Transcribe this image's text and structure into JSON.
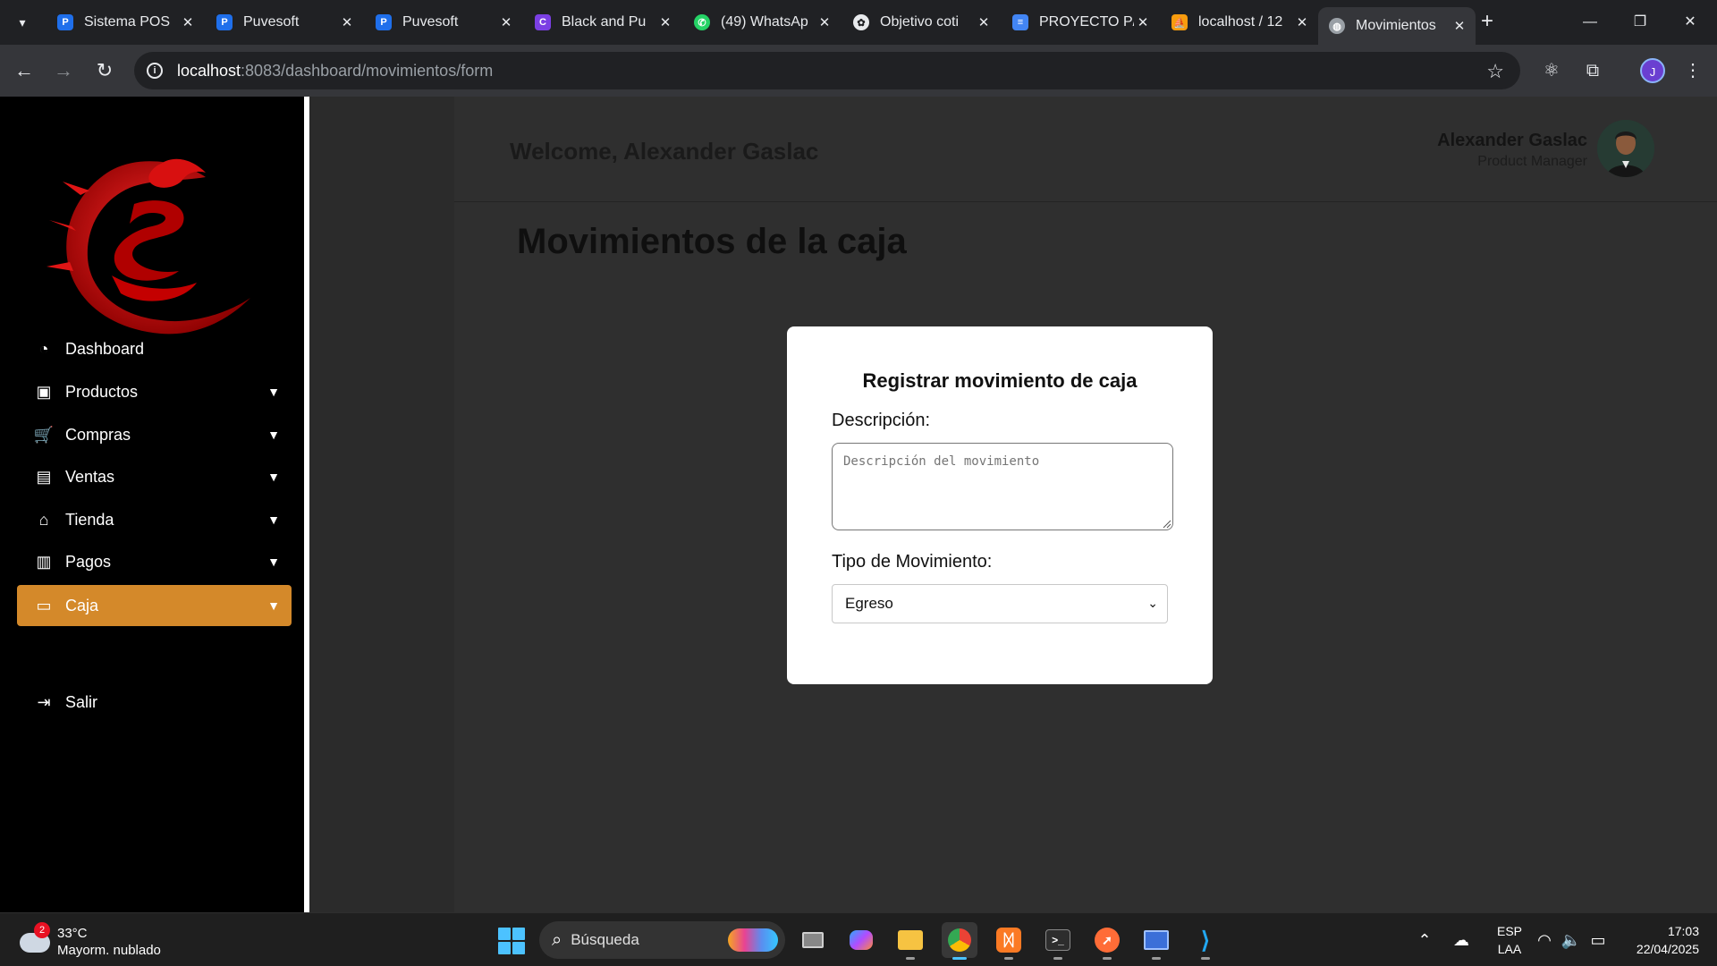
{
  "browser": {
    "tabs": [
      {
        "title": "Sistema POS",
        "icon": "puvesoft-icon"
      },
      {
        "title": "Puvesoft",
        "icon": "puvesoft-icon"
      },
      {
        "title": "Puvesoft",
        "icon": "puvesoft-icon"
      },
      {
        "title": "Black and Pu",
        "icon": "canva-icon"
      },
      {
        "title": "(49) WhatsAp",
        "icon": "whatsapp-icon"
      },
      {
        "title": "Objetivo coti",
        "icon": "openai-icon"
      },
      {
        "title": "PROYECTO P/",
        "icon": "docs-icon"
      },
      {
        "title": "localhost / 12",
        "icon": "phpmyadmin-icon"
      },
      {
        "title": "Movimientos",
        "icon": "globe-icon"
      }
    ],
    "active_tab_index": 8,
    "url_host": "localhost",
    "url_rest": ":8083/dashboard/movimientos/form",
    "profile_initial": "J"
  },
  "sidebar": {
    "items": [
      {
        "label": "Dashboard",
        "icon": "dashboard-icon",
        "has_caret": false,
        "active": false
      },
      {
        "label": "Productos",
        "icon": "box-icon",
        "has_caret": true,
        "active": false
      },
      {
        "label": "Compras",
        "icon": "cart-icon",
        "has_caret": true,
        "active": false
      },
      {
        "label": "Ventas",
        "icon": "cash-register-icon",
        "has_caret": true,
        "active": false
      },
      {
        "label": "Tienda",
        "icon": "store-icon",
        "has_caret": true,
        "active": false
      },
      {
        "label": "Pagos",
        "icon": "money-icon",
        "has_caret": true,
        "active": false
      },
      {
        "label": "Caja",
        "icon": "wallet-icon",
        "has_caret": true,
        "active": true
      }
    ],
    "logout_label": "Salir",
    "accent_color": "#d4892a"
  },
  "header": {
    "welcome": "Welcome, Alexander Gaslac",
    "user_name": "Alexander Gaslac",
    "user_role": "Product Manager"
  },
  "main": {
    "page_title": "Movimientos de la caja",
    "form": {
      "title": "Registrar movimiento de caja",
      "description_label": "Descripción:",
      "description_placeholder": "Descripción del movimiento",
      "description_value": "",
      "type_label": "Tipo de Movimiento:",
      "type_value": "Egreso"
    }
  },
  "taskbar": {
    "weather_badge": "2",
    "temperature": "33°C",
    "condition": "Mayorm. nublado",
    "search_placeholder": "Búsqueda",
    "apps": [
      "task-view-icon",
      "copilot-icon",
      "file-explorer-icon",
      "chrome-icon",
      "xampp-icon",
      "terminal-icon",
      "postman-icon",
      "remote-desktop-icon",
      "vscode-icon"
    ],
    "language": "ESP",
    "keyboard_layout": "LAA",
    "time": "17:03",
    "date": "22/04/2025"
  }
}
